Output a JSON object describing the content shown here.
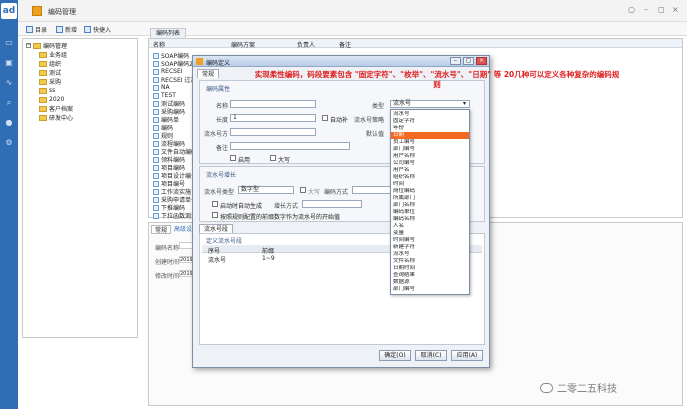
{
  "app": {
    "logo": "ad",
    "title": "编码管理"
  },
  "window_controls": [
    "○",
    "–",
    "◻",
    "×"
  ],
  "toolbar": {
    "items": [
      "目录",
      "新增",
      "快捷入"
    ]
  },
  "tree": {
    "root": "编码管理",
    "items": [
      "业务组",
      "组织",
      "测试",
      "采购",
      "ss",
      "2020",
      "客户档案",
      "研发中心"
    ]
  },
  "grid": {
    "tab": "编码列表",
    "columns": [
      "名称",
      "编码方案",
      "负责人",
      "备注"
    ],
    "rows": [
      "SOAP编码",
      "SOAP编码2",
      "RECSEI",
      "RECSEI 过滤",
      "NA",
      "TEST",
      "测试编码",
      "采购编码",
      "编码单",
      "编码",
      "规则",
      "流程编码",
      "文件自动编码",
      "领料编码",
      "项目编码",
      "项目设计编号",
      "项目编号",
      "工作流实施",
      "采购申请单号",
      "下推编码",
      "下拉函数测试"
    ]
  },
  "bottom": {
    "tabs": [
      "常规",
      "高级设置"
    ],
    "fields": [
      "编码名称",
      "创建时间",
      "修改时间"
    ],
    "values": [
      "",
      "2019",
      "2019"
    ]
  },
  "dialog": {
    "title": "编码定义",
    "tab_general": "常规",
    "section_prop": "编码属性",
    "labels": {
      "name": "名称",
      "length": "长度",
      "prefix": "流水号方",
      "note": "备注",
      "type": "类型",
      "auto_increment": "流水号策略",
      "default_value": "默认值"
    },
    "values": {
      "length": "1",
      "type": "流水号"
    },
    "checkbox_fill": "自动补",
    "chk_enable": "启用",
    "chk_upper": "大写",
    "section_serial": "流水号增长",
    "serial_label": "流水号类型",
    "serial_value": "数字型",
    "serial_chk1": "大写",
    "serial_chk2": "启动时自动生成",
    "serial_chk3": "按照规则配置的前缀数字作为流水号的开始值",
    "other_labels": [
      "编码方式",
      "增长方式"
    ],
    "table_tab": "流水号段",
    "table_subtitle": "定义流水号段",
    "table_cols": [
      "序号",
      "前缀"
    ],
    "table_row": [
      "流水号",
      "1~9"
    ],
    "btn_ok": "确定(O)",
    "btn_cancel": "取消(C)",
    "btn_apply": "应用(A)"
  },
  "dropdown_options": [
    "流水号",
    "固定字符",
    "年份",
    "日期",
    "员工编号",
    "部门编号",
    "用户名称",
    "公司编号",
    "用户名",
    "组织名称",
    "时间",
    "岗位编码",
    "所属部门",
    "部门名称",
    "编码单位",
    "编码名称",
    "人名",
    "变量",
    "时间编号",
    "新建字符",
    "流水号",
    "文件名称",
    "日期时间",
    "查询结果",
    "数据源",
    "部门编号"
  ],
  "dropdown_selected_index": 3,
  "annotation": "实现柔性编码，码段要素包含 \"固定字符\"、\"枚举\"、\"流水号\"、\"日期\" 等 20几种可以定义各种复杂的编码规则",
  "watermark": "二零二五科技"
}
